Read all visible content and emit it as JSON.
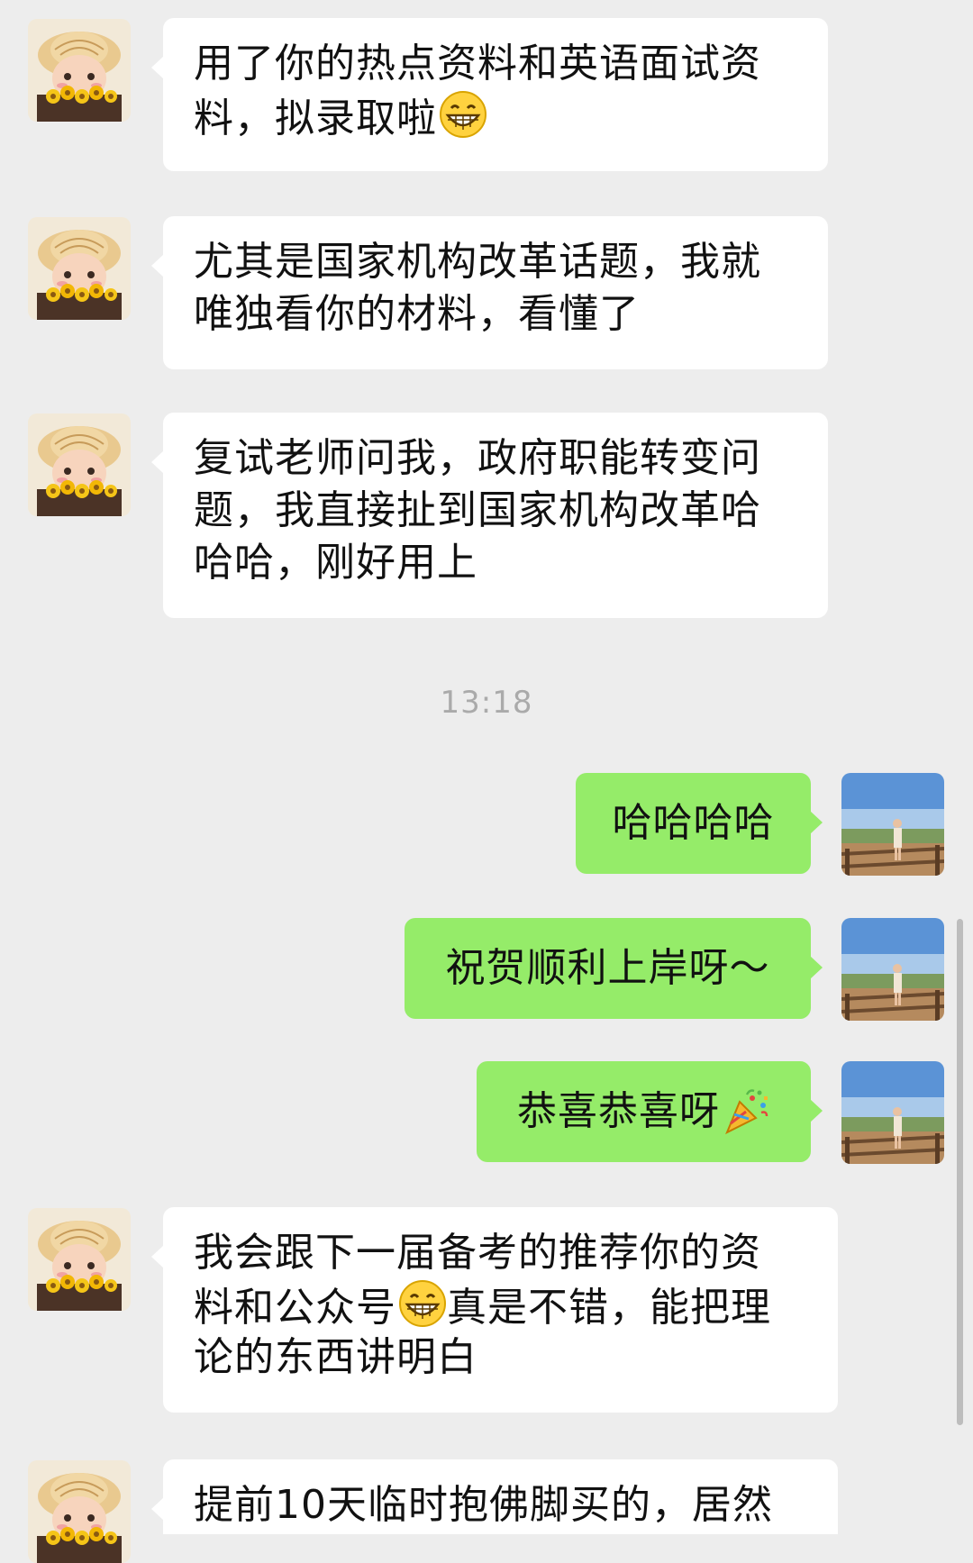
{
  "timestamp": "13:18",
  "messages": [
    {
      "sender": "contact",
      "lines": [
        "用了你的热点资料和英语面试资",
        "料，拟录取啦"
      ],
      "emoji": "grin-emoji"
    },
    {
      "sender": "contact",
      "lines": [
        "尤其是国家机构改革话题，我就",
        "唯独看你的材料，看懂了"
      ]
    },
    {
      "sender": "contact",
      "lines": [
        "复试老师问我，政府职能转变问",
        "题，我直接扯到国家机构改革哈",
        "哈哈，刚好用上"
      ]
    },
    {
      "sender": "me",
      "text": "哈哈哈哈"
    },
    {
      "sender": "me",
      "text": "祝贺顺利上岸呀～"
    },
    {
      "sender": "me",
      "text": "恭喜恭喜呀",
      "emoji": "party-popper-emoji"
    },
    {
      "sender": "contact",
      "lines": [
        "我会跟下一届备考的推荐你的资",
        "料和公众号",
        "真是不错，能把理",
        "论的东西讲明白"
      ],
      "emoji": "grin-emoji"
    },
    {
      "sender": "contact",
      "lines": [
        "提前10天临时抱佛脚买的，居然"
      ]
    }
  ],
  "colors": {
    "background": "#ededed",
    "incoming_bubble": "#ffffff",
    "outgoing_bubble": "#95ec69",
    "timestamp": "#aaaaaa"
  }
}
